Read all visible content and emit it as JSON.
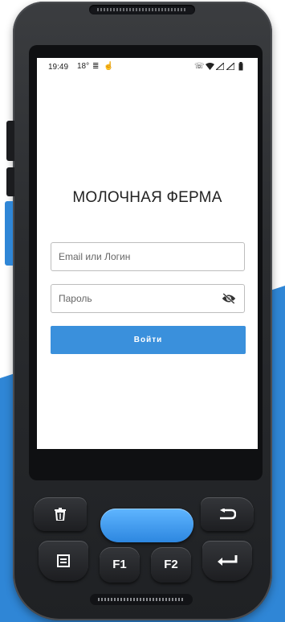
{
  "status_bar": {
    "time": "19:49",
    "temperature": "18°"
  },
  "app": {
    "title": "МОЛОЧНАЯ ФЕРМА"
  },
  "login_form": {
    "login_placeholder": "Email или Логин",
    "password_placeholder": "Пароль",
    "submit_label": "Войти"
  },
  "hardware_keys": {
    "f1_label": "F1",
    "f2_label": "F2"
  },
  "colors": {
    "accent": "#3a90dc",
    "scan_key": "#3a9bf0",
    "background_shape": "#2f86d6"
  }
}
